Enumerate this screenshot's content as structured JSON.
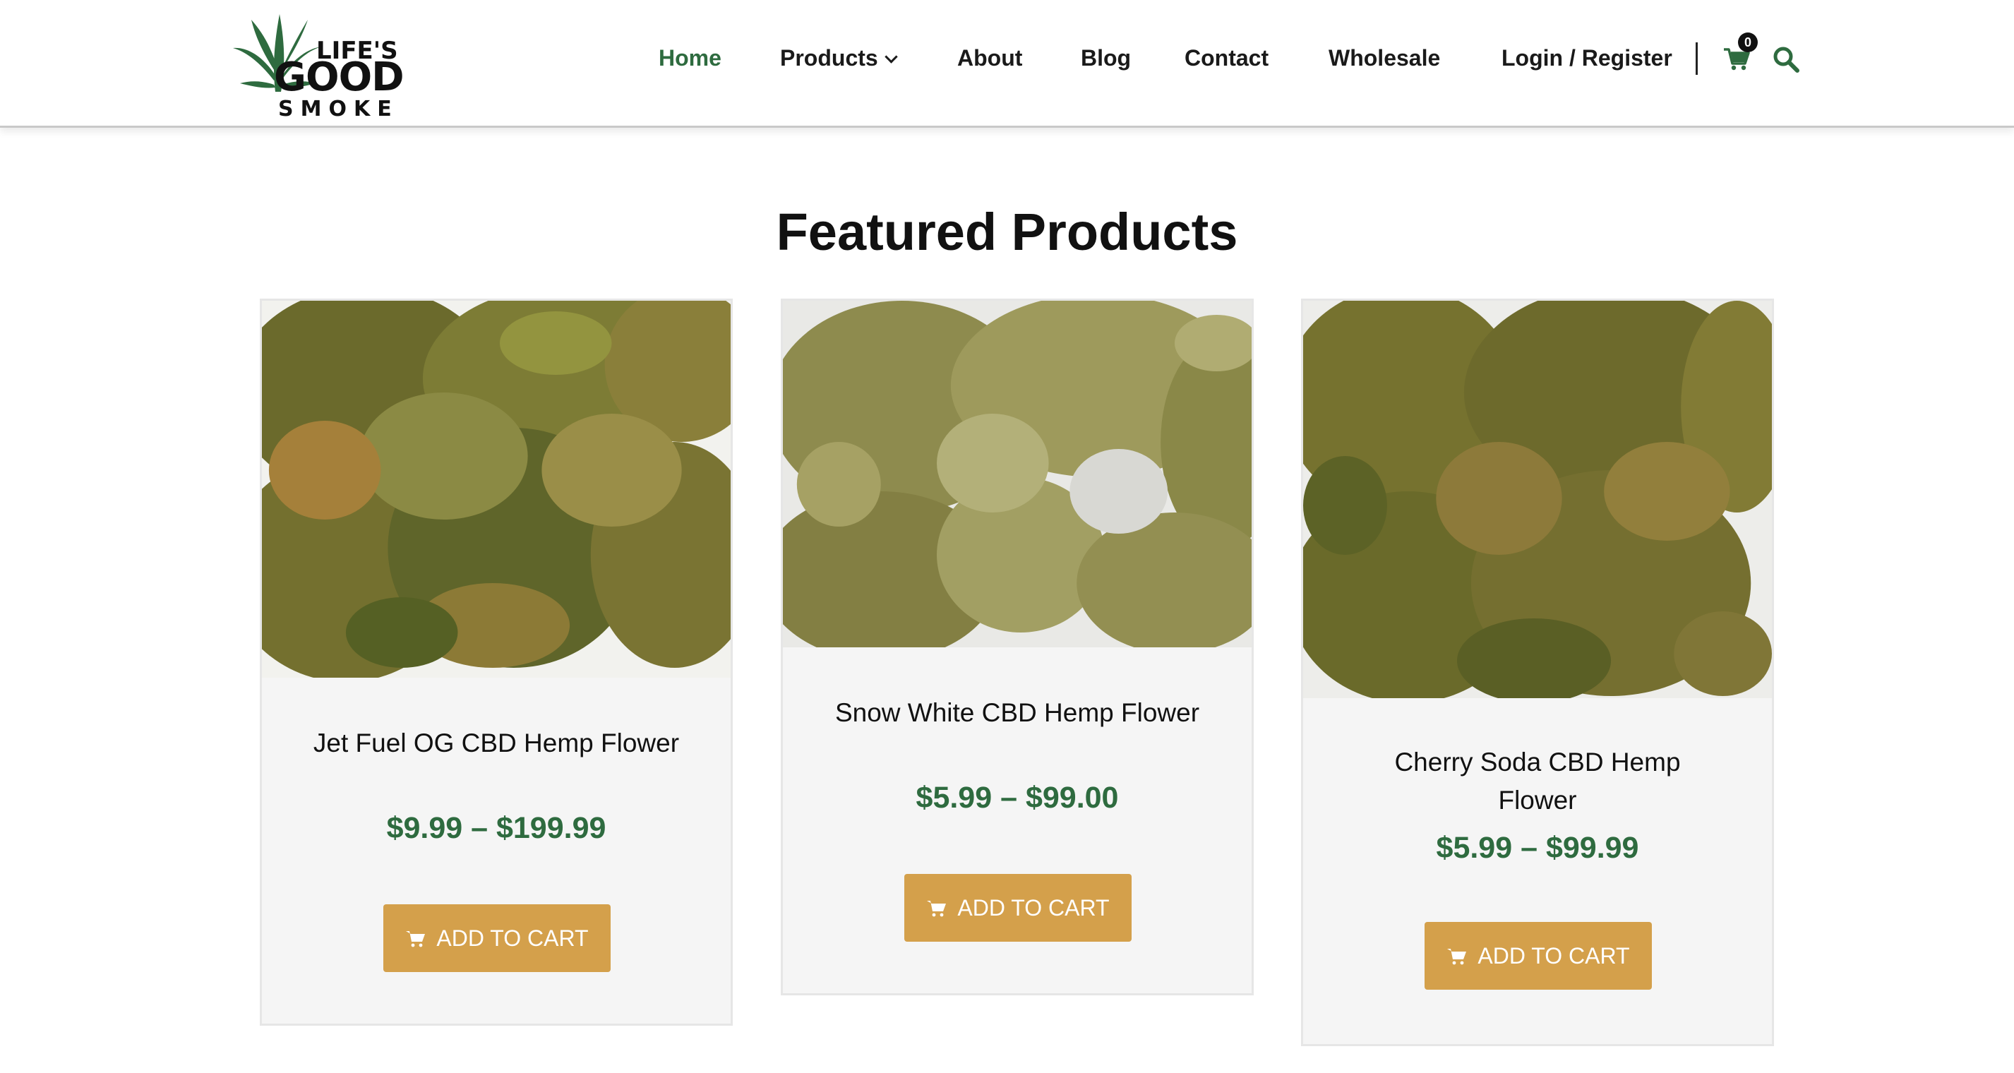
{
  "brand": {
    "logo_line1": "LIFE'S",
    "logo_line2": "GOOD",
    "logo_line3": "SMOKE",
    "leaf_color": "#2e6b3f"
  },
  "nav": {
    "items": [
      {
        "label": "Home",
        "active": true
      },
      {
        "label": "Products",
        "has_dropdown": true
      },
      {
        "label": "About"
      },
      {
        "label": "Blog"
      },
      {
        "label": "Contact"
      },
      {
        "label": "Wholesale"
      },
      {
        "label": "Login / Register"
      }
    ],
    "cart_count": "0",
    "cart_icon": "cart-icon",
    "search_icon": "search-icon"
  },
  "featured": {
    "title": "Featured Products",
    "products": [
      {
        "name": "Jet Fuel OG CBD Hemp Flower",
        "price": "$9.99 – $199.99",
        "button": "ADD TO CART"
      },
      {
        "name": "Snow White CBD Hemp Flower",
        "price": "$5.99 – $99.00",
        "button": "ADD TO CART"
      },
      {
        "name": "Cherry Soda CBD Hemp Flower",
        "price": "$5.99 – $99.99",
        "button": "ADD TO CART"
      }
    ]
  },
  "colors": {
    "accent_green": "#2e6b3f",
    "button_gold": "#d4a04b",
    "card_bg": "#f5f5f5"
  }
}
